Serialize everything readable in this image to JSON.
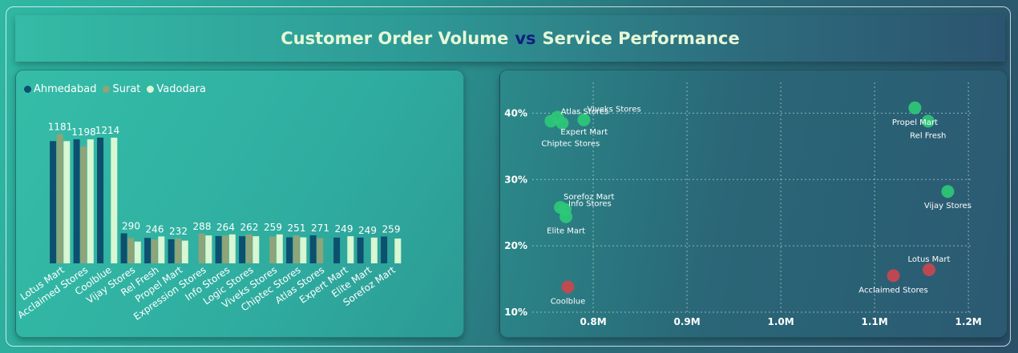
{
  "header": {
    "title_part1": "Customer Order Volume",
    "title_part2": "vs",
    "title_part3": "Service Performance"
  },
  "colors": {
    "Ahmedabad": "#0d4f6e",
    "Surat": "#8fa478",
    "Vadodara": "#d8f7d2",
    "good": "#2ec878",
    "bad": "#c9474e"
  },
  "chart_data": [
    {
      "type": "bar",
      "categories": [
        "Lotus Mart",
        "Acclaimed Stores",
        "Coolblue",
        "Vijay Stores",
        "Rel Fresh",
        "Propel Mart",
        "Expression Stores",
        "Info Stores",
        "Logic Stores",
        "Viveks Stores",
        "Chiptec Stores",
        "Atlas Stores",
        "Expert Mart",
        "Elite Mart",
        "Sorefoz Mart"
      ],
      "series": [
        {
          "name": "Ahmedabad",
          "values": [
            1181,
            1198,
            1214,
            290,
            246,
            232,
            null,
            264,
            262,
            null,
            251,
            271,
            249,
            249,
            259
          ]
        },
        {
          "name": "Surat",
          "values": [
            1250,
            1130,
            null,
            245,
            230,
            240,
            288,
            270,
            280,
            259,
            270,
            245,
            null,
            null,
            null
          ]
        },
        {
          "name": "Vadodara",
          "values": [
            1181,
            1198,
            1214,
            210,
            260,
            220,
            270,
            280,
            262,
            280,
            251,
            null,
            262,
            249,
            240
          ]
        }
      ],
      "data_labels": [
        {
          "category": "Lotus Mart",
          "value": 1181
        },
        {
          "category": "Acclaimed Stores",
          "value": 1198
        },
        {
          "category": "Coolblue",
          "value": 1214
        },
        {
          "category": "Vijay Stores",
          "value": 290
        },
        {
          "category": "Rel Fresh",
          "value": 246
        },
        {
          "category": "Propel Mart",
          "value": 232
        },
        {
          "category": "Expression Stores",
          "value": 288
        },
        {
          "category": "Info Stores",
          "value": 264
        },
        {
          "category": "Logic Stores",
          "value": 262
        },
        {
          "category": "Viveks Stores",
          "value": 259
        },
        {
          "category": "Chiptec Stores",
          "value": 251
        },
        {
          "category": "Atlas Stores",
          "value": 271
        },
        {
          "category": "Expert Mart",
          "value": 249
        },
        {
          "category": "Elite Mart",
          "value": 249
        },
        {
          "category": "Sorefoz Mart",
          "value": 259
        }
      ],
      "legend_position": "top-left",
      "ylim": [
        0,
        1400
      ]
    },
    {
      "type": "scatter",
      "x_ticks": [
        {
          "v": 0.8,
          "label": "0.8M"
        },
        {
          "v": 0.9,
          "label": "0.9M"
        },
        {
          "v": 1.0,
          "label": "1.0M"
        },
        {
          "v": 1.1,
          "label": "1.1M"
        },
        {
          "v": 1.2,
          "label": "1.2M"
        }
      ],
      "y_ticks": [
        {
          "v": 10,
          "label": "10%"
        },
        {
          "v": 20,
          "label": "20%"
        },
        {
          "v": 30,
          "label": "30%"
        },
        {
          "v": 40,
          "label": "40%"
        }
      ],
      "xlim": [
        0.735,
        1.205
      ],
      "ylim": [
        10,
        45
      ],
      "grid": true,
      "points": [
        {
          "name": "Viveks Stores",
          "x": 0.79,
          "y": 39.0,
          "status": "good",
          "label_pos": "above-right"
        },
        {
          "name": "Atlas Stores",
          "x": 0.762,
          "y": 39.4,
          "status": "good",
          "label_pos": "right"
        },
        {
          "name": "Expert Mart",
          "x": 0.767,
          "y": 38.5,
          "status": "good",
          "label_pos": "below-right"
        },
        {
          "name": "Chiptec Stores",
          "x": 0.755,
          "y": 38.8,
          "status": "good",
          "label_pos": "below-far"
        },
        {
          "name": "Propel Mart",
          "x": 1.143,
          "y": 40.8,
          "status": "good",
          "label_pos": "below"
        },
        {
          "name": "Rel Fresh",
          "x": 1.157,
          "y": 38.8,
          "status": "good",
          "label_pos": "below"
        },
        {
          "name": "Vijay Stores",
          "x": 1.178,
          "y": 28.2,
          "status": "good",
          "label_pos": "below"
        },
        {
          "name": "Sorefoz Mart",
          "x": 0.765,
          "y": 25.8,
          "status": "good",
          "label_pos": "above-right"
        },
        {
          "name": "Info Stores",
          "x": 0.77,
          "y": 25.5,
          "status": "good",
          "label_pos": "right"
        },
        {
          "name": "Elite Mart",
          "x": 0.771,
          "y": 24.4,
          "status": "good",
          "label_pos": "below"
        },
        {
          "name": "Coolblue",
          "x": 0.773,
          "y": 13.8,
          "status": "bad",
          "label_pos": "below"
        },
        {
          "name": "Acclaimed Stores",
          "x": 1.12,
          "y": 15.5,
          "status": "bad",
          "label_pos": "below"
        },
        {
          "name": "Lotus Mart",
          "x": 1.158,
          "y": 16.4,
          "status": "bad",
          "label_pos": "above"
        }
      ]
    }
  ]
}
